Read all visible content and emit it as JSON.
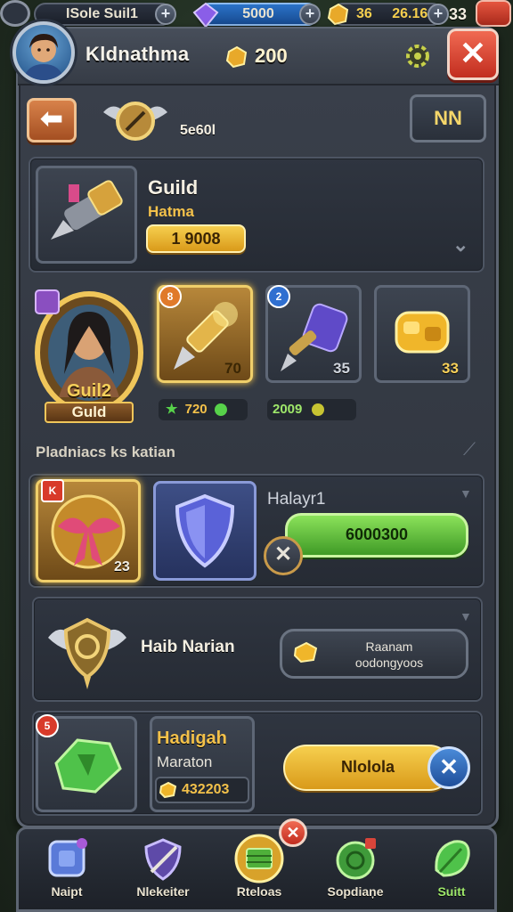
{
  "topbar": {
    "left_label": "ISole Suil1",
    "gems": "5000",
    "gold_a": "36",
    "gold_b": "26.16",
    "right_value": "33"
  },
  "header": {
    "player_name": "Kldnathma",
    "gold_amount": "200"
  },
  "subheader": {
    "emblem_label": "5e60l",
    "right_button": "NN"
  },
  "guild_card": {
    "title": "Guild",
    "subtitle": "Hatma",
    "value": "1 9008"
  },
  "hero": {
    "name_top": "Guil2",
    "name_bottom": "Guld"
  },
  "items": [
    {
      "badge": "8",
      "count": "70"
    },
    {
      "badge": "2",
      "count": "35"
    },
    {
      "badge": "",
      "count": "33"
    }
  ],
  "stats": [
    {
      "value": "720"
    },
    {
      "value": "2009"
    }
  ],
  "section_title": "Pladniacs ks katian",
  "reward_row": {
    "gift_badge": "K",
    "gift_count": "23",
    "title": "Halayr1",
    "button": "6000300"
  },
  "rank_row": {
    "title": "Haib Narian",
    "button_line1": "Raanam",
    "button_line2": "oodongyoos"
  },
  "quest_row": {
    "badge": "5",
    "title": "Hadigah",
    "subtitle": "Maraton",
    "value": "432203",
    "button": "Nlolola"
  },
  "nav": [
    {
      "label": "Naipt",
      "icon": "shield-cube-icon"
    },
    {
      "label": "Nlekeiter",
      "icon": "sword-shield-icon"
    },
    {
      "label": "Rteloas",
      "icon": "chest-icon",
      "badge": "x"
    },
    {
      "label": "Sopdiaņe",
      "icon": "globe-icon"
    },
    {
      "label": "Suitt",
      "icon": "leaf-icon"
    }
  ],
  "colors": {
    "accent_gold": "#f6cf4e",
    "accent_green": "#8be25a",
    "close_red": "#e04a36"
  }
}
